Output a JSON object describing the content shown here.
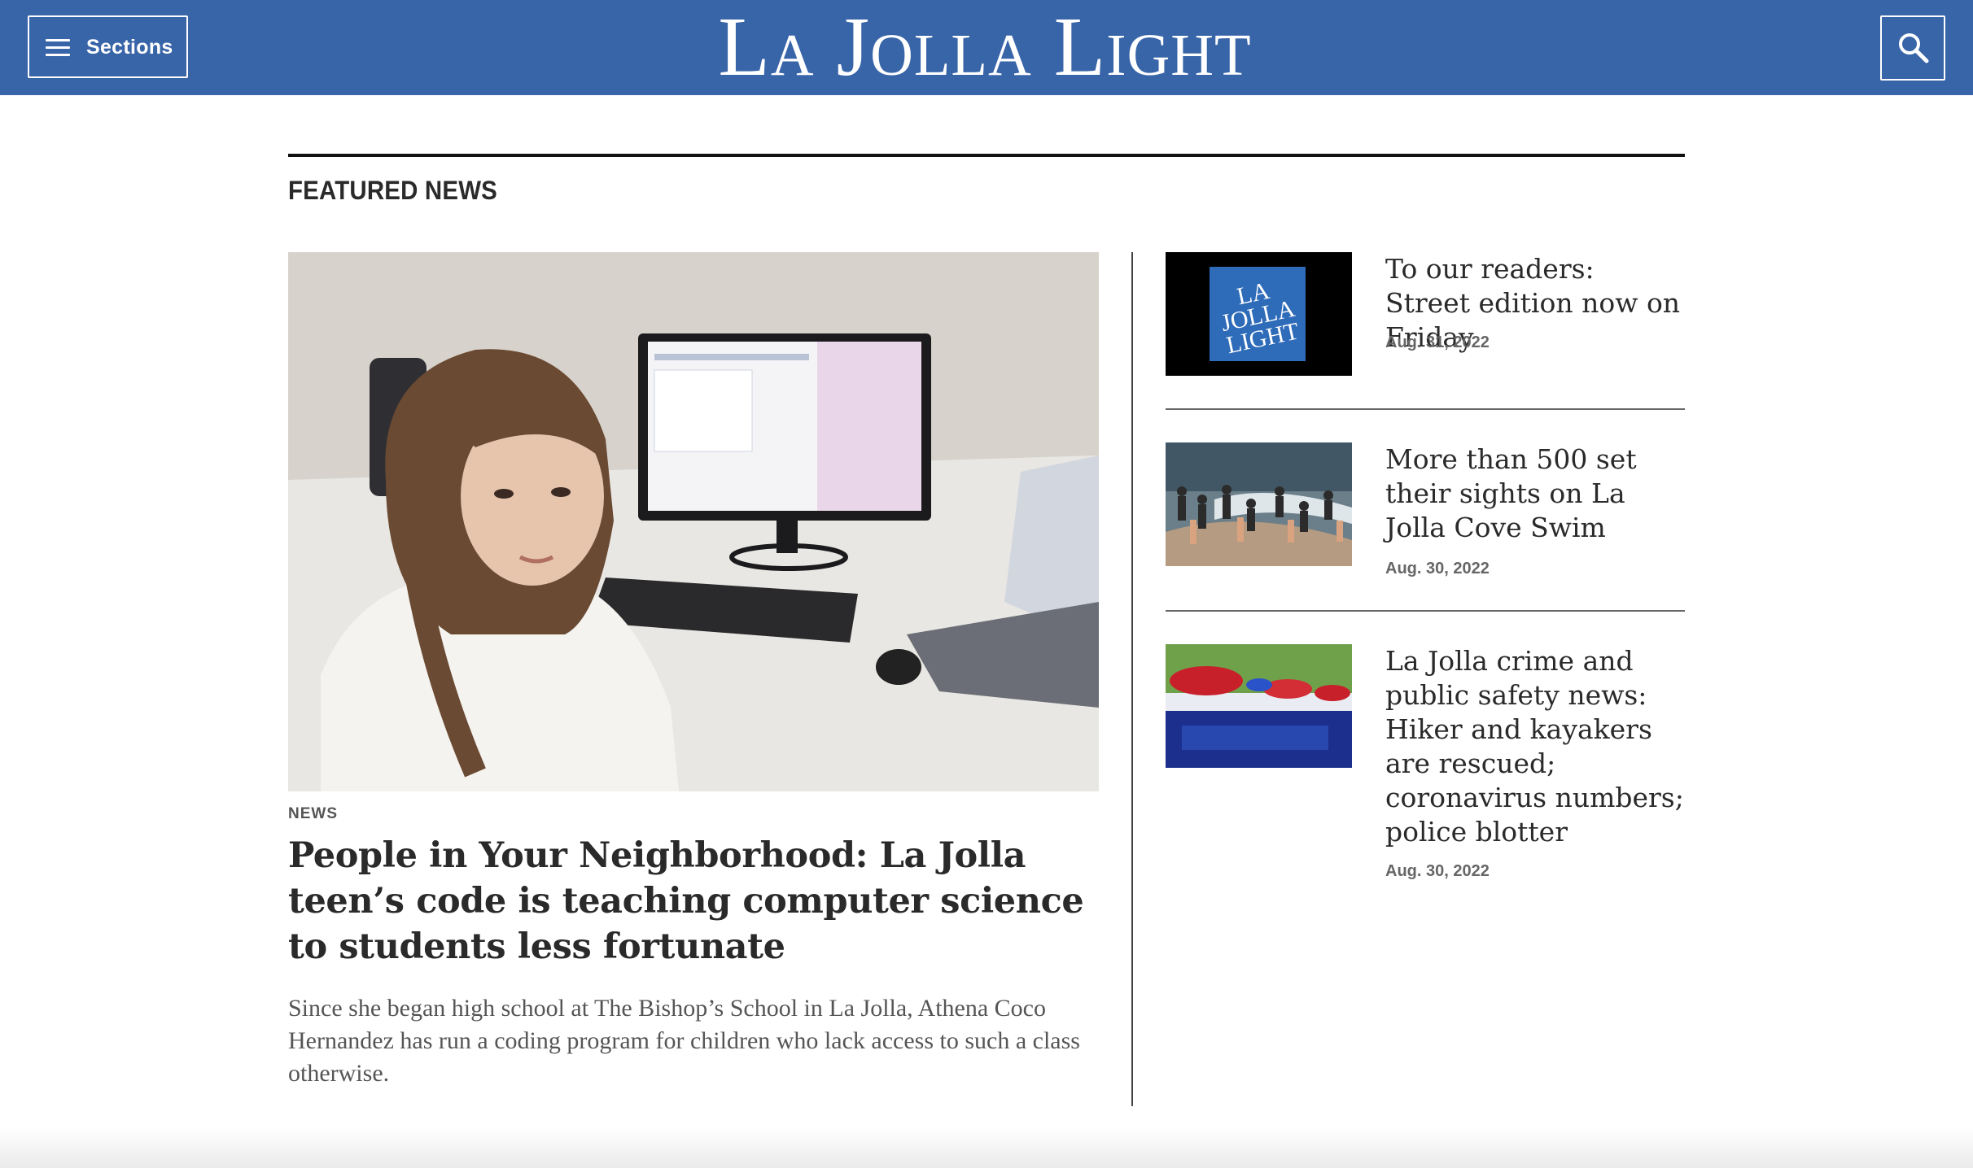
{
  "header": {
    "sections_label": "Sections",
    "masthead": "La Jolla Light",
    "brand_color": "#3864a8"
  },
  "featured": {
    "title": "FEATURED NEWS",
    "lead": {
      "kicker": "NEWS",
      "headline": "People in Your Neighborhood: La Jolla teen’s code is teaching computer science to students less fortunate",
      "dek": "Since she began high school at The Bishop’s School in La Jolla, Athena Coco Hernandez has run a coding program for children who lack access to such a class otherwise."
    },
    "side": [
      {
        "headline": "To our readers: Street edition now on Friday",
        "date": "Aug. 31, 2022",
        "thumb_logo": "LA JOLLA LIGHT"
      },
      {
        "headline": "More than 500 set their sights on La Jolla Cove Swim",
        "date": "Aug. 30, 2022"
      },
      {
        "headline": "La Jolla crime and public safety news: Hiker and kayakers are rescued; coronavirus numbers; police blotter",
        "date": "Aug. 30, 2022"
      }
    ]
  }
}
